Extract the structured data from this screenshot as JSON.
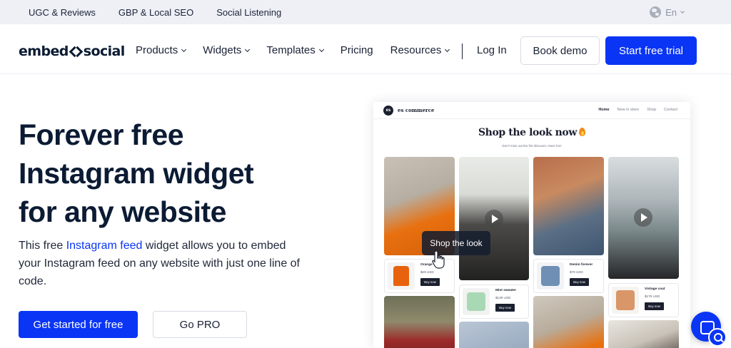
{
  "topbar": {
    "links": [
      "UGC & Reviews",
      "GBP & Local SEO",
      "Social Listening"
    ],
    "language": "En"
  },
  "nav": {
    "logo_left": "embed",
    "logo_right": "social",
    "menu": [
      "Products",
      "Widgets",
      "Templates",
      "Pricing",
      "Resources"
    ],
    "login": "Log In",
    "book_demo": "Book demo",
    "start_trial": "Start free trial"
  },
  "hero": {
    "title_lines": [
      "Forever free",
      "Instagram widget",
      "for any website"
    ],
    "desc_before": "This free ",
    "desc_link": "Instagram feed",
    "desc_after": " widget allows you to embed your Instagram feed on any website with just one line of code.",
    "cta_primary": "Get started for free",
    "cta_secondary": "Go PRO"
  },
  "mockup": {
    "logo_initials": "es",
    "brand": "es commerce",
    "nav_links": [
      "Home",
      "New in store",
      "Shop",
      "Contact"
    ],
    "title": "Shop the look now",
    "subtitle": "Don't miss out the fire discount. Have fun!",
    "tooltip": "Shop the look",
    "products": [
      {
        "name": "Orange",
        "price": "$29 USD",
        "buy": "Buy now"
      },
      {
        "name": "Mint sweater",
        "price": "$139 USD",
        "buy": "Buy now"
      },
      {
        "name": "Denim forever",
        "price": "$79 USD",
        "buy": "Buy now"
      },
      {
        "name": "Vintage coat",
        "price": "$179 USD",
        "buy": "Buy now"
      }
    ]
  },
  "colors": {
    "accent": "#0a35f5",
    "text_dark": "#0b1b33",
    "topbar_bg": "#eef0f6"
  },
  "icons": [
    "globe-icon",
    "chevron-down-icon",
    "play-icon",
    "hand-cursor-icon",
    "chat-icon",
    "search-icon",
    "flame-icon"
  ]
}
